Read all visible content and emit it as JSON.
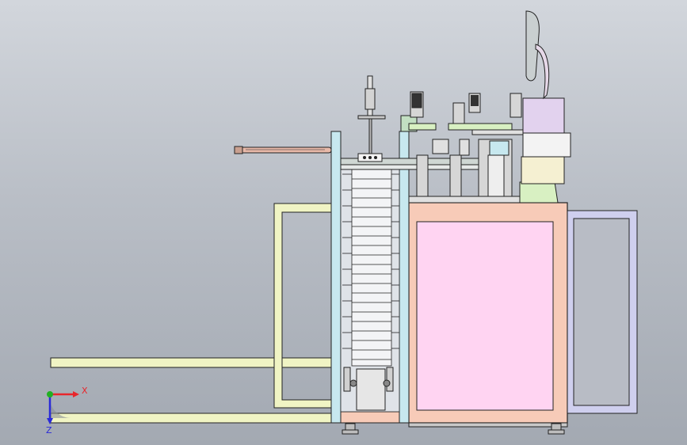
{
  "viewport": {
    "background_top": "#d2d6dc",
    "background_bottom": "#a3a9b2"
  },
  "triad": {
    "x_label": "X",
    "z_label": "Z",
    "x_color": "#e8262b",
    "y_color": "#22b022",
    "z_color": "#2a2ad8"
  },
  "colors": {
    "cabinet": "#f7cbb8",
    "panel_pink": "#ffd4f2",
    "door_frame": "#cfcfee",
    "frame_yellow": "#f0f4c4",
    "frame_blue": "#c7e8ef",
    "rod": "#e8b9a9",
    "column_gray": "#d6d6d6",
    "top_purple": "#e2d2ee",
    "green_plate": "#d8f0c2"
  }
}
